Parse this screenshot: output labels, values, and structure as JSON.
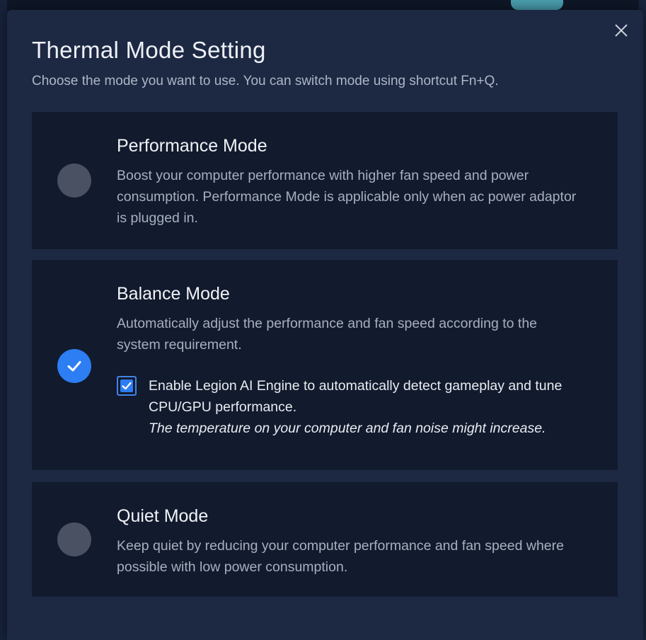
{
  "dialog": {
    "title": "Thermal Mode Setting",
    "subtitle": "Choose the mode you want to use. You can switch mode using shortcut Fn+Q.",
    "close_icon": "close-icon"
  },
  "modes": [
    {
      "title": "Performance Mode",
      "description": "Boost your computer performance with higher fan speed and power consumption. Performance Mode is applicable only when ac power adaptor is plugged in.",
      "selected": false
    },
    {
      "title": "Balance Mode",
      "description": "Automatically adjust the performance and fan speed according to the system requirement.",
      "selected": true,
      "ai_engine": {
        "checked": true,
        "label": "Enable Legion AI Engine to automatically detect gameplay and tune CPU/GPU performance.",
        "note": "The temperature on your computer and fan noise might increase."
      }
    },
    {
      "title": "Quiet Mode",
      "description": "Keep quiet by reducing your computer performance and fan speed where possible with low power consumption.",
      "selected": false
    }
  ],
  "colors": {
    "dialog_bg": "#1d2943",
    "card_bg": "#121a2d",
    "accent": "#2d7df3",
    "radio_unselected": "#4a5163"
  }
}
